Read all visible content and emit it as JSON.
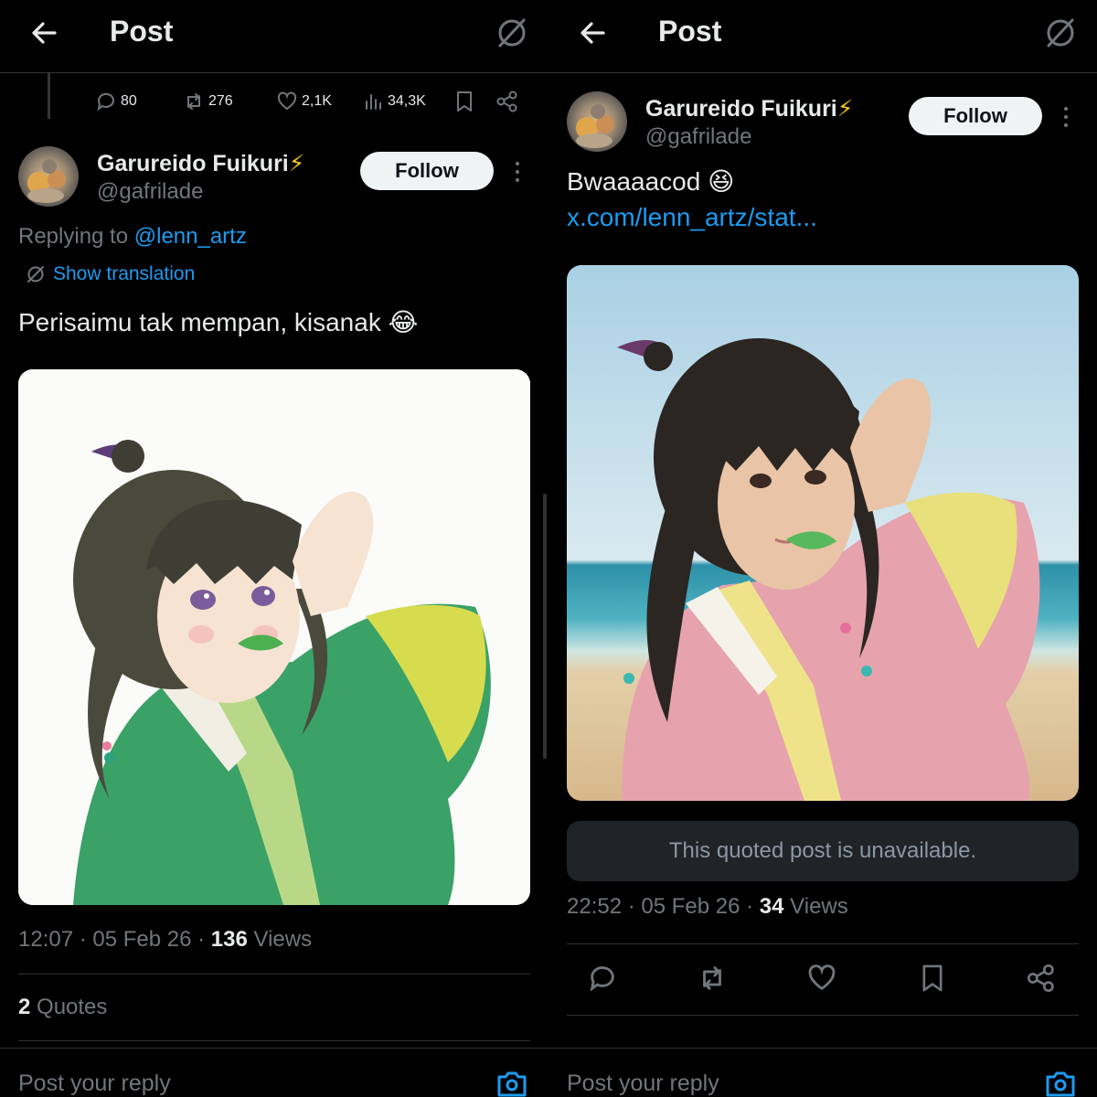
{
  "colors": {
    "background": "#000000",
    "text": "#e7e9ea",
    "muted": "#71767b",
    "accent": "#1d9bf0",
    "follow_bg": "#eff3f4"
  },
  "left": {
    "header": {
      "title": "Post"
    },
    "parent_stats": {
      "replies": "80",
      "reposts": "276",
      "likes": "2,1K",
      "views": "34,3K"
    },
    "author": {
      "name": "Garureido Fuikuri",
      "badge": "⚡",
      "handle": "@gafrilade"
    },
    "follow_label": "Follow",
    "replying_prefix": "Replying to ",
    "replying_to": "@lenn_artz",
    "show_translation": "Show translation",
    "text": "Perisaimu tak mempan, kisanak",
    "emoji": "😂",
    "meta": {
      "time": "12:07 · 05 Feb 26 · ",
      "views": "136",
      "views_label": " Views"
    },
    "quotes": {
      "count": "2",
      "label": " Quotes"
    },
    "reply_placeholder": "Post your reply"
  },
  "right": {
    "header": {
      "title": "Post"
    },
    "author": {
      "name": "Garureido Fuikuri",
      "badge": "⚡",
      "handle": "@gafrilade"
    },
    "follow_label": "Follow",
    "text": "Bwaaaacod",
    "emoji": "😆",
    "link": "x.com/lenn_artz/stat...",
    "quoted_unavailable": "This quoted post is unavailable.",
    "meta": {
      "time": "22:52 · 05 Feb 26 · ",
      "views": "34",
      "views_label": " Views"
    },
    "reply_placeholder": "Post your reply"
  }
}
